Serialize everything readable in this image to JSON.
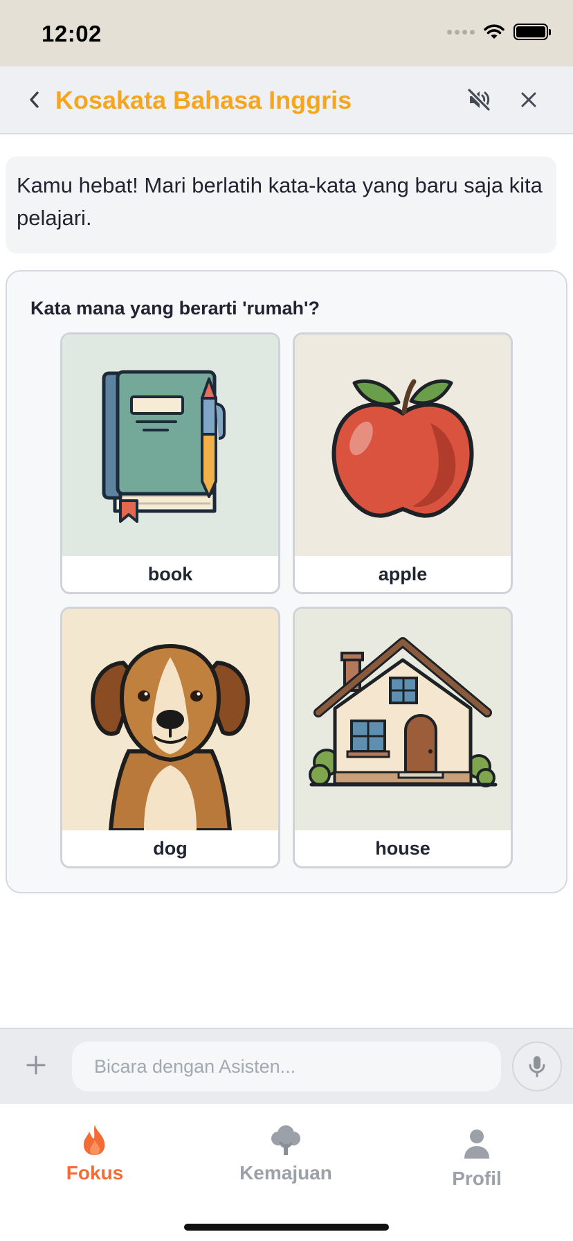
{
  "status_bar": {
    "time": "12:02"
  },
  "header": {
    "title": "Kosakata Bahasa Inggris",
    "back_icon": "chevron-left-icon",
    "mute_icon": "speaker-muted-icon",
    "close_icon": "close-icon",
    "title_color": "#f7a51c"
  },
  "message": {
    "text": "Kamu hebat! Mari berlatih kata-kata yang baru saja kita pelajari."
  },
  "quiz": {
    "question": "Kata mana yang berarti 'rumah'?",
    "options": [
      {
        "label": "book",
        "image": "book-illustration"
      },
      {
        "label": "apple",
        "image": "apple-illustration"
      },
      {
        "label": "dog",
        "image": "dog-illustration"
      },
      {
        "label": "house",
        "image": "house-illustration"
      }
    ]
  },
  "input_bar": {
    "placeholder": "Bicara dengan Asisten...",
    "plus_icon": "plus-icon",
    "mic_icon": "microphone-icon"
  },
  "bottom_nav": {
    "items": [
      {
        "label": "Fokus",
        "icon": "flame-icon",
        "active": true
      },
      {
        "label": "Kemajuan",
        "icon": "tree-icon",
        "active": false
      },
      {
        "label": "Profil",
        "icon": "person-icon",
        "active": false
      }
    ],
    "active_color": "#f36b35",
    "inactive_color": "#9ca0a8"
  }
}
